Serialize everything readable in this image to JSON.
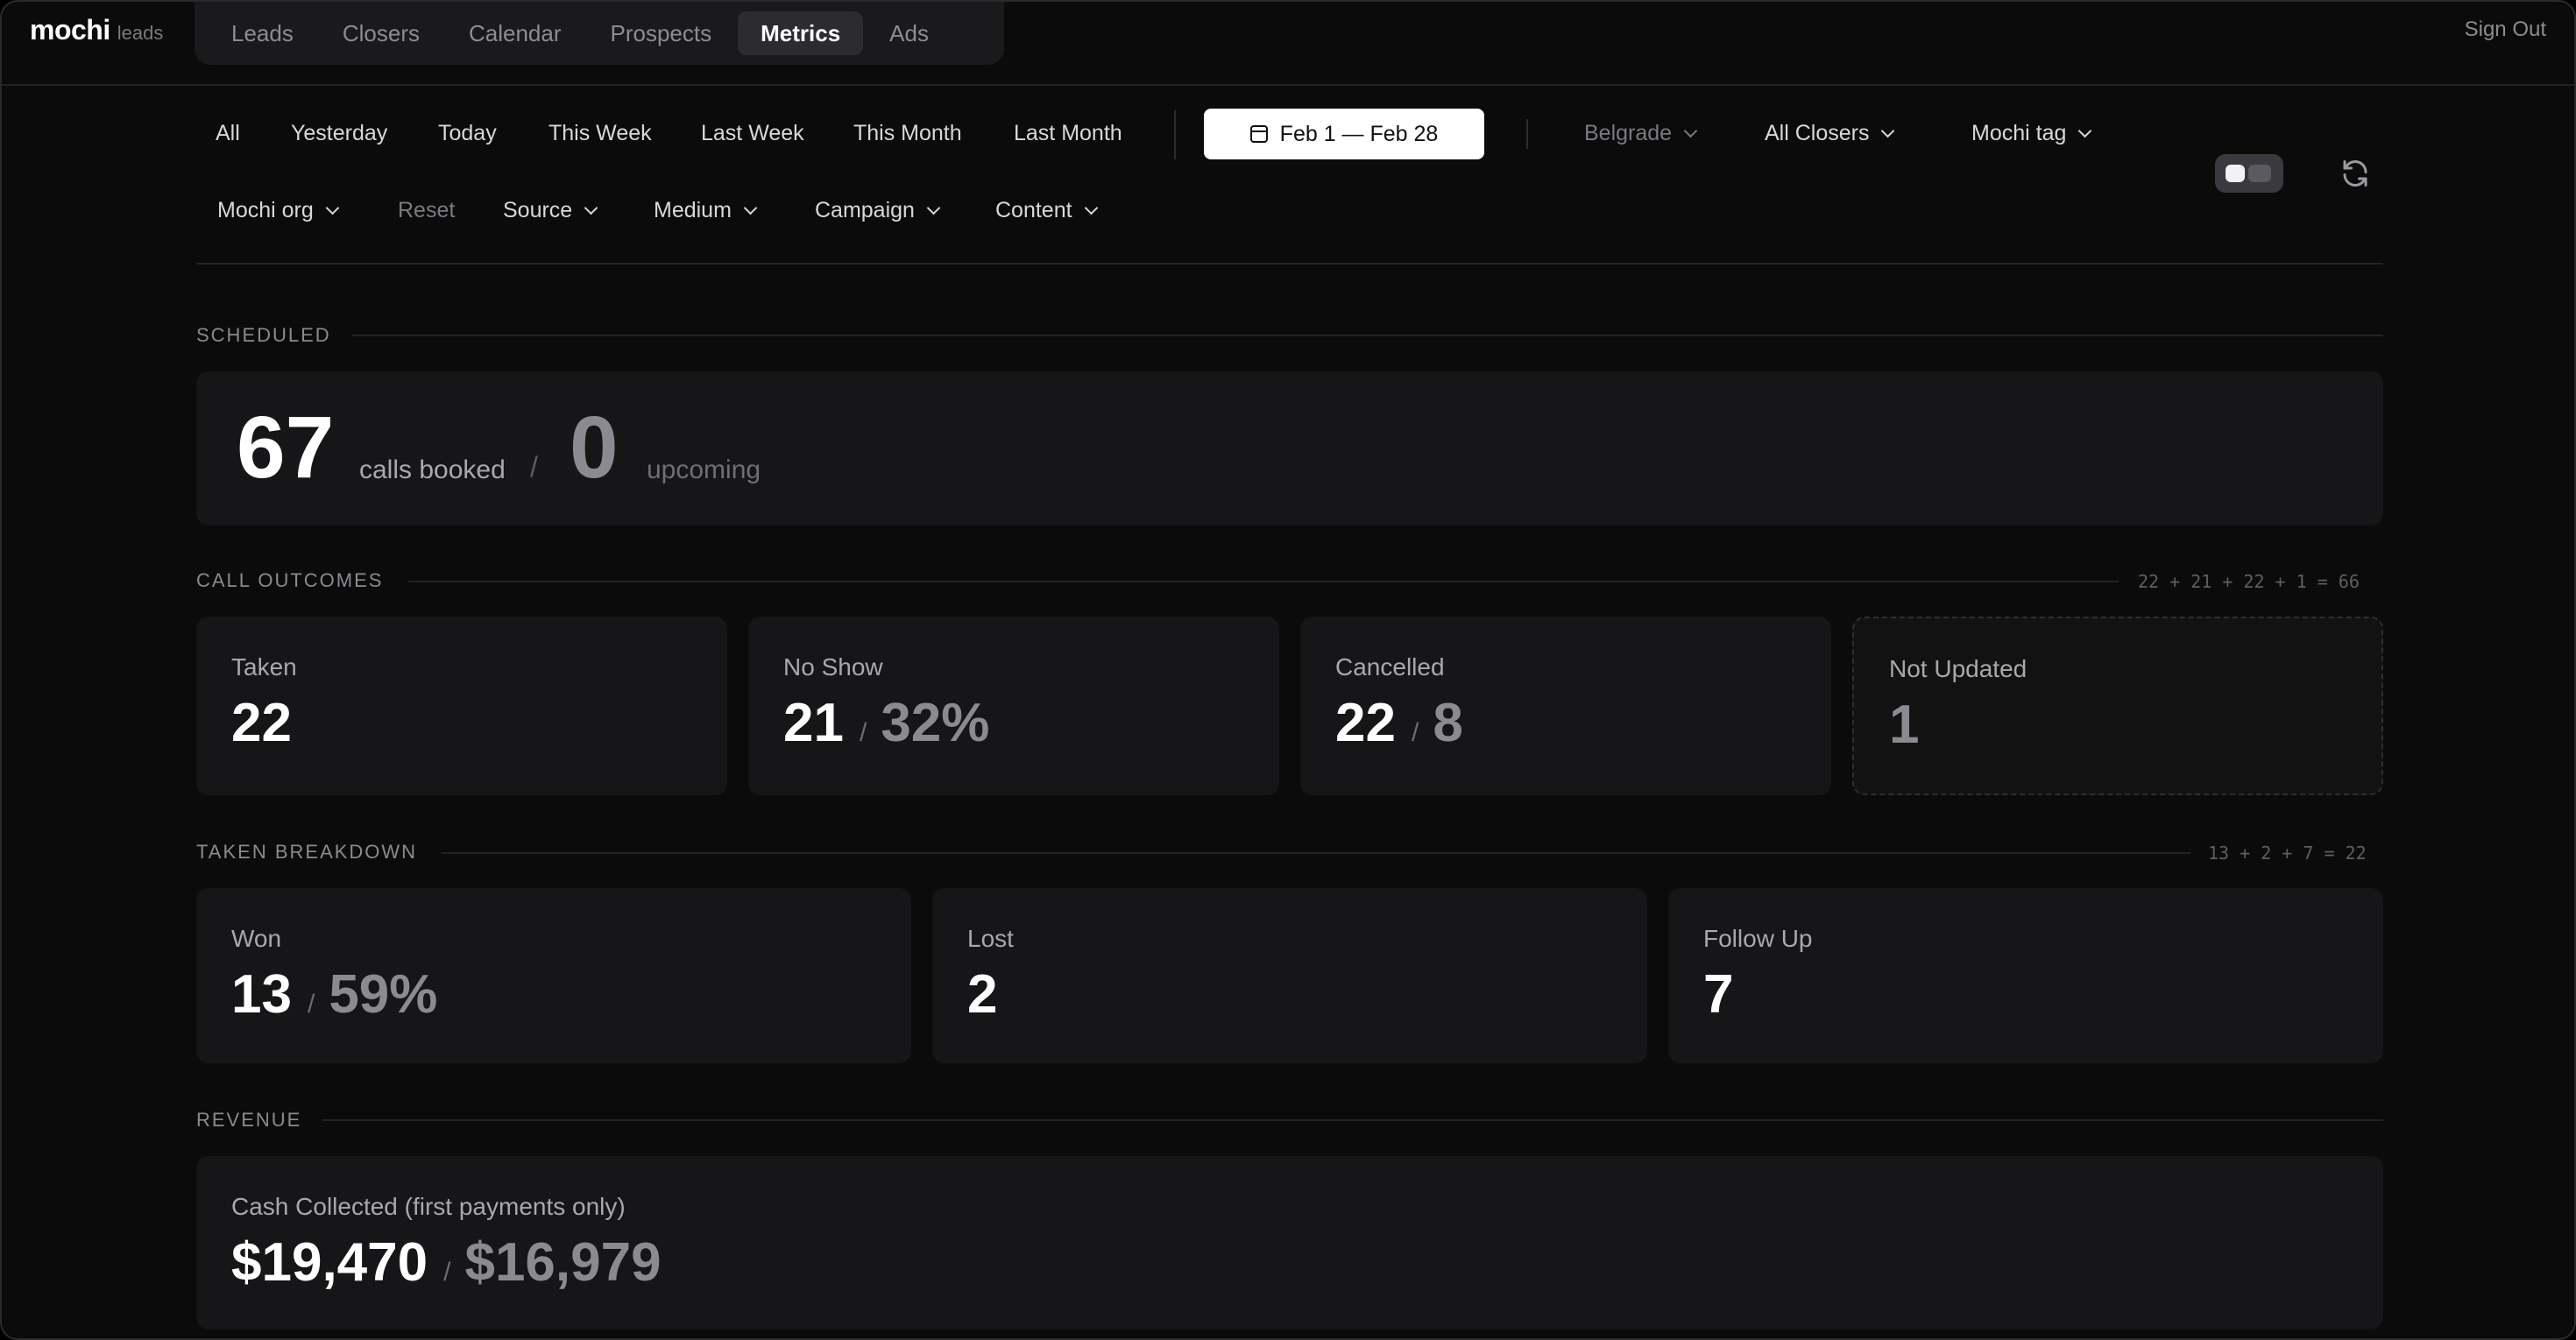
{
  "brand": {
    "name": "mochi",
    "sub": "leads"
  },
  "nav": {
    "tabs": [
      {
        "label": "Leads"
      },
      {
        "label": "Closers"
      },
      {
        "label": "Calendar"
      },
      {
        "label": "Prospects"
      },
      {
        "label": "Metrics",
        "active": true
      },
      {
        "label": "Ads"
      }
    ],
    "sign_out": "Sign Out"
  },
  "filters": {
    "ranges": [
      "All",
      "Yesterday",
      "Today",
      "This Week",
      "Last Week",
      "This Month",
      "Last Month"
    ],
    "date_range": "Feb 1 — Feb 28",
    "timezone": "Belgrade",
    "closers": "All Closers",
    "tag": "Mochi tag",
    "org": "Mochi org",
    "reset": "Reset",
    "source": "Source",
    "medium": "Medium",
    "campaign": "Campaign",
    "content": "Content"
  },
  "scheduled": {
    "label": "SCHEDULED",
    "booked": "67",
    "booked_caption": "calls booked",
    "separator": "/",
    "upcoming": "0",
    "upcoming_caption": "upcoming"
  },
  "outcomes": {
    "label": "CALL OUTCOMES",
    "sum": "22 + 21 + 22 + 1 = 66",
    "taken": {
      "label": "Taken",
      "value": "22"
    },
    "no_show": {
      "label": "No Show",
      "value": "21",
      "sub": "32%"
    },
    "cancelled": {
      "label": "Cancelled",
      "value": "22",
      "sub": "8"
    },
    "not_updated": {
      "label": "Not Updated",
      "value": "1"
    }
  },
  "taken_breakdown": {
    "label": "TAKEN BREAKDOWN",
    "sum": "13 + 2 + 7 = 22",
    "won": {
      "label": "Won",
      "value": "13",
      "sub": "59%"
    },
    "lost": {
      "label": "Lost",
      "value": "2"
    },
    "follow_up": {
      "label": "Follow Up",
      "value": "7"
    }
  },
  "revenue": {
    "label": "REVENUE",
    "cash": {
      "label": "Cash Collected (first payments only)",
      "value": "$19,470",
      "sub": "$16,979"
    }
  },
  "slash": "/"
}
